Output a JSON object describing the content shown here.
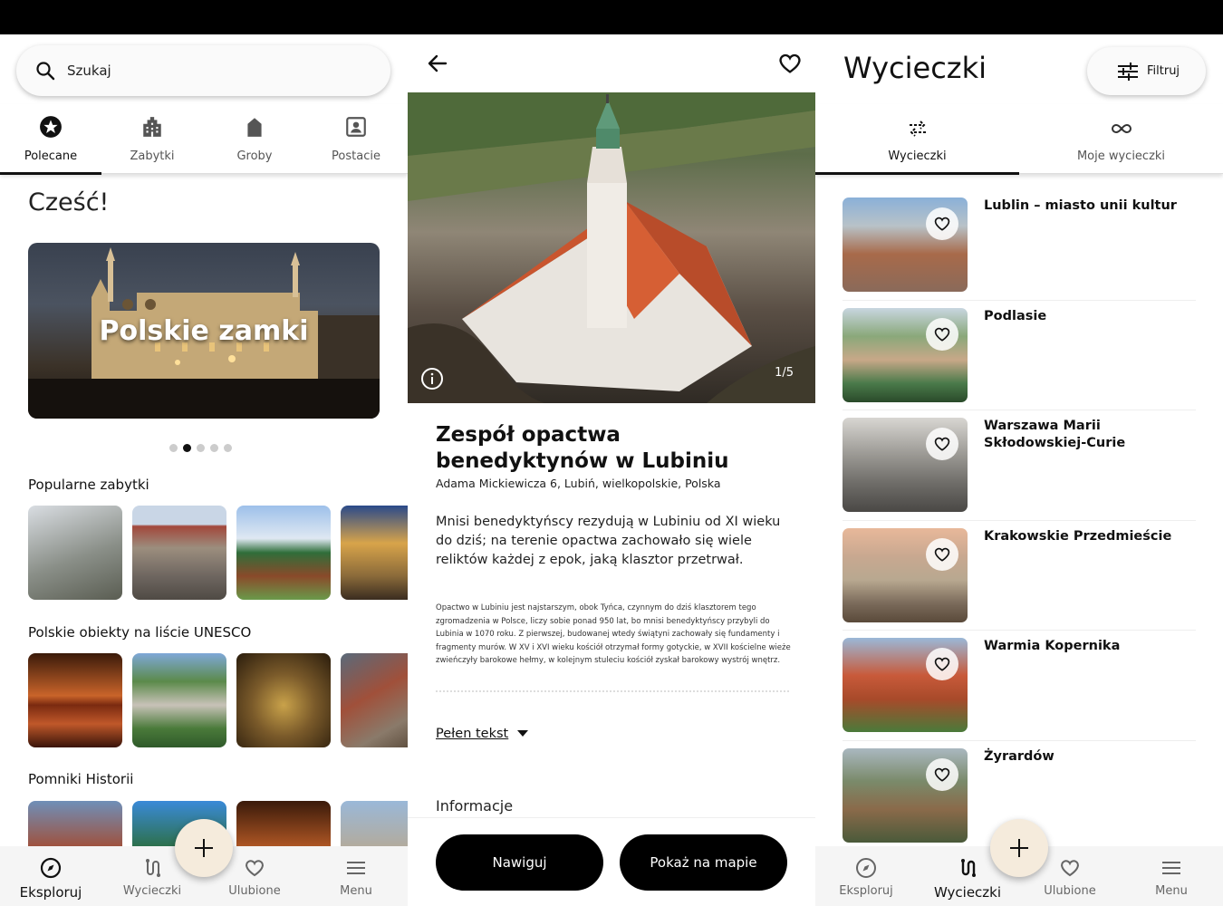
{
  "explore": {
    "search": {
      "placeholder": "Szukaj"
    },
    "categories": [
      {
        "label": "Polecane",
        "icon": "star-badge-icon"
      },
      {
        "label": "Zabytki",
        "icon": "building-icon"
      },
      {
        "label": "Groby",
        "icon": "tombstone-icon"
      },
      {
        "label": "Postacie",
        "icon": "person-portrait-icon"
      }
    ],
    "greeting": "Cześć!",
    "hero": {
      "title": "Polskie zamki",
      "slide_index": 1,
      "slide_count": 5
    },
    "sections": [
      {
        "title": "Popularne zabytki"
      },
      {
        "title": "Polskie obiekty na liście UNESCO"
      },
      {
        "title": "Pomniki Historii"
      }
    ]
  },
  "bottom_nav": {
    "items": [
      {
        "label": "Eksploruj",
        "icon": "compass-icon"
      },
      {
        "label": "Wycieczki",
        "icon": "route-icon"
      },
      {
        "label": "Ulubione",
        "icon": "heart-icon"
      },
      {
        "label": "Menu",
        "icon": "hamburger-icon"
      }
    ],
    "fab": "+"
  },
  "detail": {
    "photo_counter": "1/5",
    "title": "Zespół opactwa benedyktynów w Lubiniu",
    "address": "Adama Mickiewicza 6, Lubiń, wielkopolskie, Polska",
    "lead": "Mnisi benedyktyńscy rezydują w Lubiniu od XI wieku do dziś; na terenie opactwa zachowało się wiele reliktów każdej z epok, jaką klasztor przetrwał.",
    "body": "Opactwo w Lubiniu jest najstarszym, obok Tyńca, czynnym do dziś klasztorem tego zgromadzenia w Polsce, liczy sobie ponad 950 lat, bo mnisi benedyktyńscy przybyli do Lubinia w 1070 roku. Z pierwszej, budowanej wtedy świątyni zachowały się fundamenty i fragmenty murów. W XV i XVI wieku kościół otrzymał formy gotyckie, w XVII kościelne wieże zwieńczyły barokowe hełmy, w kolejnym stuleciu kościół zyskał barokowy wystrój wnętrz.",
    "full_text_label": "Pełen tekst",
    "info_title": "Informacje",
    "navigate_label": "Nawiguj",
    "map_label": "Pokaż na mapie"
  },
  "trips": {
    "title": "Wycieczki",
    "filter_label": "Filtruj",
    "tabs": [
      {
        "label": "Wycieczki",
        "icon": "swap-arrows-icon"
      },
      {
        "label": "Moje wycieczki",
        "icon": "infinity-icon"
      }
    ],
    "items": [
      {
        "name": "Lublin – miasto unii kultur"
      },
      {
        "name": "Podlasie"
      },
      {
        "name": "Warszawa Marii Skłodowskiej-Curie"
      },
      {
        "name": "Krakowskie Przedmieście"
      },
      {
        "name": "Warmia Kopernika"
      },
      {
        "name": "Żyrardów"
      }
    ]
  }
}
